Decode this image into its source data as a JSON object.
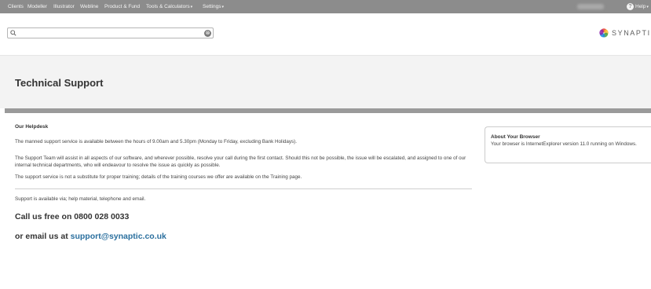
{
  "nav": {
    "items": [
      {
        "label": "Clients"
      },
      {
        "label": "Modeller"
      },
      {
        "label": "Illustrator"
      },
      {
        "label": "Webline"
      },
      {
        "label": "Product & Fund"
      },
      {
        "label": "Tools & Calculators",
        "caret": "▾"
      },
      {
        "label": "Settings",
        "caret": "▾"
      }
    ],
    "help_label": "Help",
    "help_caret": "▾",
    "help_icon": "?"
  },
  "search": {
    "value": "",
    "placeholder": "",
    "icon": "search-icon",
    "clear_icon": "⊗"
  },
  "brand": {
    "name": "SYNAPTIC",
    "colors": [
      "#e53935",
      "#fbc02d",
      "#43a047",
      "#1e88e5",
      "#8e24aa"
    ]
  },
  "page": {
    "title": "Technical Support"
  },
  "helpdesk": {
    "heading": "Our Helpdesk",
    "p1": "The manned support service is available between the hours of 9.00am and 5.30pm (Monday to Friday, excluding Bank Holidays).",
    "p2": "The Support Team will assist in all aspects of our software, and wherever possible, resolve your call during the first contact. Should this not be possible, the issue will be escalated, and assigned to one of our internal technical departments, who will endeavour to resolve the issue as quickly as possible.",
    "p3": "The support service is not a substitute for proper training; details of the training courses we offer are available on the Training page.",
    "p4": "Support is available via; help material, telephone and email.",
    "call": "Call us free on 0800 028 0033",
    "email_prefix": "or email us at",
    "email": "support@synaptic.co.uk"
  },
  "browser_panel": {
    "title": "About Your Browser",
    "text": "Your browser is InternetExplorer version 11.0 running on Windows."
  },
  "colors": {
    "nav_bg": "#8c8c8c",
    "title_band": "#f3f3f3",
    "rule": "#9a9a9a",
    "link": "#2a6f9e"
  }
}
